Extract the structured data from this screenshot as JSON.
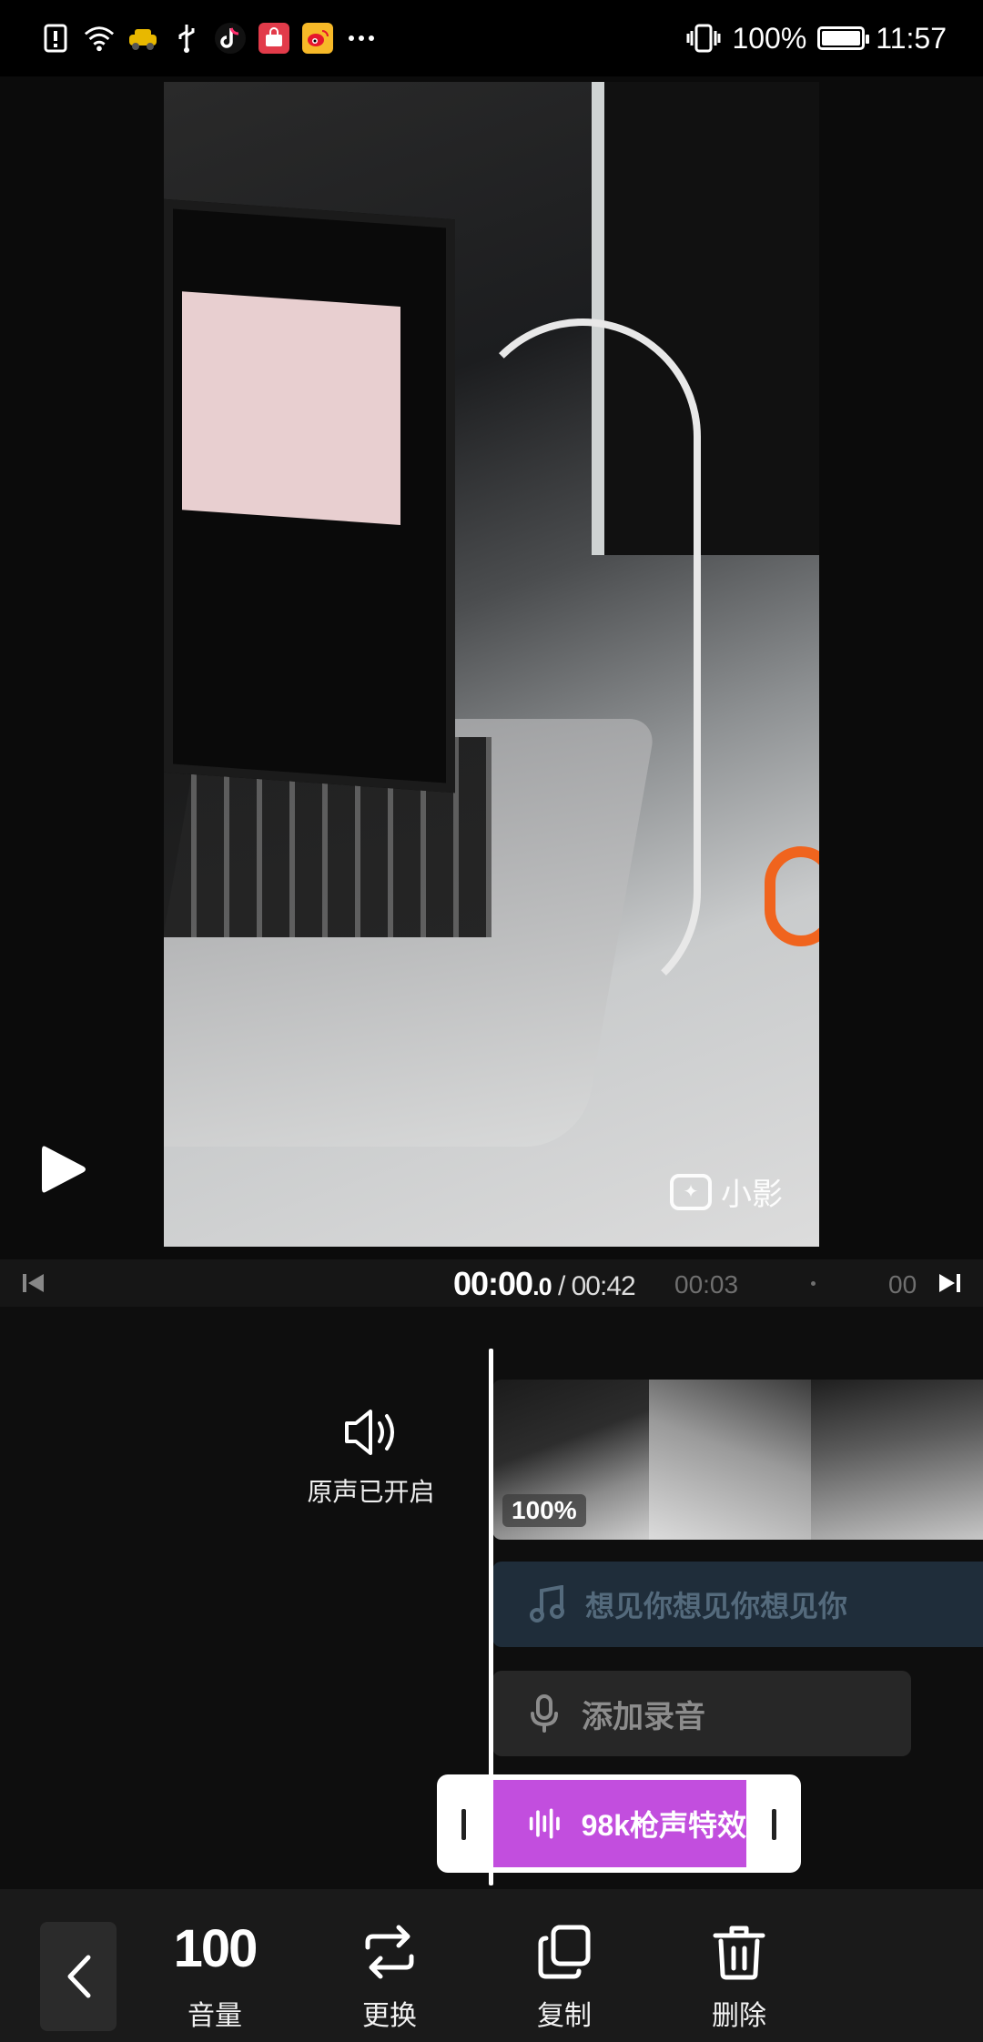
{
  "status_bar": {
    "battery_percent": "100%",
    "time": "11:57",
    "left_icons": [
      "alert-icon",
      "wifi-icon",
      "taxi-icon",
      "usb-icon",
      "tiktok-icon",
      "shopping-icon",
      "weibo-icon",
      "more-icon"
    ]
  },
  "preview": {
    "watermark": "小影"
  },
  "timebar": {
    "current": "00:00",
    "current_frac": ".0",
    "total": " / 00:42",
    "tick_1": "00:03",
    "tick_2": "00"
  },
  "timeline": {
    "original_sound_label": "原声已开启",
    "video_volume": "100%",
    "music_track_label": "想见你想见你想见你",
    "record_track_label": "添加录音",
    "effect_label": "98k枪声特效"
  },
  "toolbar": {
    "volume_value": "100",
    "volume_label": "音量",
    "replace_label": "更换",
    "copy_label": "复制",
    "delete_label": "删除"
  },
  "colors": {
    "effect_clip": "#c24ede",
    "music_track": "#1f2d3a",
    "record_track": "#272727",
    "background": "#0b0b0b"
  }
}
